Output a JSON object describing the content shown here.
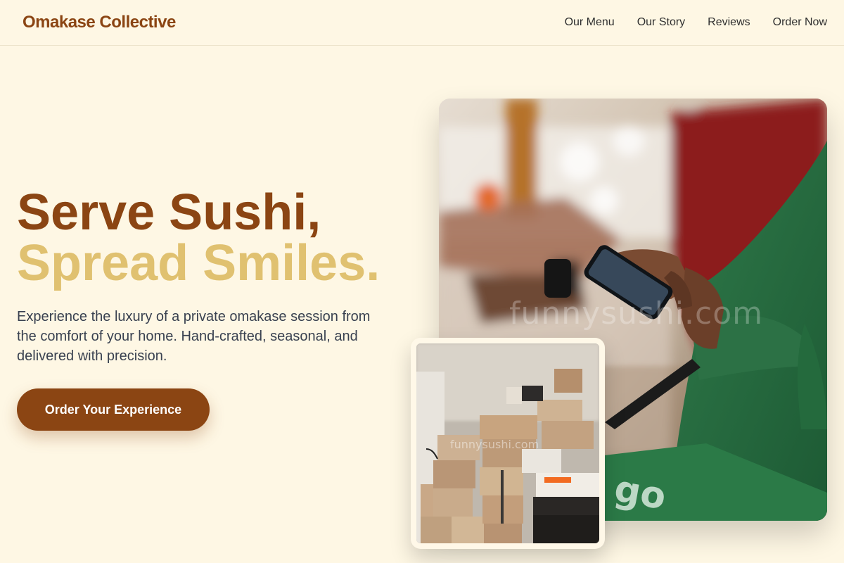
{
  "brand": {
    "name": "Omakase Collective"
  },
  "nav": {
    "items": [
      {
        "label": "Our Menu"
      },
      {
        "label": "Our Story"
      },
      {
        "label": "Reviews"
      },
      {
        "label": "Order Now"
      }
    ]
  },
  "hero": {
    "title_line1": "Serve Sushi,",
    "title_line2": "Spread Smiles.",
    "description": "Experience the luxury of a private omakase session from the comfort of your home. Hand-crafted, seasonal, and delivered with precision.",
    "cta_label": "Order Your Experience"
  },
  "images": {
    "main": {
      "subject": "delivery courier in green jacket holding smartphone at counter",
      "watermark": "funnysushi.com"
    },
    "secondary": {
      "subject": "stacked cardboard delivery boxes",
      "watermark": "funnysushi.com"
    }
  },
  "colors": {
    "background": "#fef7e4",
    "brand": "#8b4513",
    "accent": "#e0c170",
    "text": "#394150"
  }
}
